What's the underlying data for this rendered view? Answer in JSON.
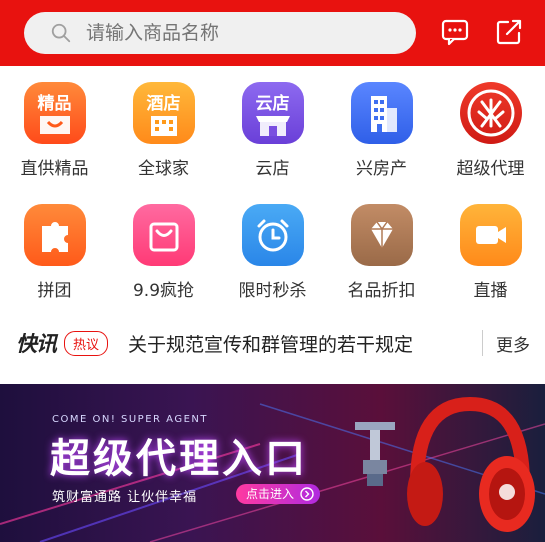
{
  "search": {
    "placeholder": "请输入商品名称"
  },
  "grid": [
    {
      "tile_text": "精品",
      "label": "直供精品",
      "icon": "bag-icon",
      "color": "#ff6a2a"
    },
    {
      "tile_text": "酒店",
      "label": "全球家",
      "icon": "hotel-icon",
      "color": "#ffa21a"
    },
    {
      "tile_text": "云店",
      "label": "云店",
      "icon": "store-icon",
      "color": "#7a4fe0"
    },
    {
      "tile_text": "",
      "label": "兴房产",
      "icon": "building-icon",
      "color": "#3f6ff0"
    },
    {
      "tile_text": "",
      "label": "超级代理",
      "icon": "agent-icon",
      "color": "#e8251f"
    },
    {
      "tile_text": "",
      "label": "拼团",
      "icon": "puzzle-icon",
      "color": "#ff7a2a"
    },
    {
      "tile_text": "",
      "label": "9.9疯抢",
      "icon": "shopping-bag-icon",
      "color": "#ff4f86"
    },
    {
      "tile_text": "",
      "label": "限时秒杀",
      "icon": "alarm-clock-icon",
      "color": "#3a9cf0"
    },
    {
      "tile_text": "",
      "label": "名品折扣",
      "icon": "diamond-icon",
      "color": "#b07a55"
    },
    {
      "tile_text": "",
      "label": "直播",
      "icon": "video-camera-icon",
      "color": "#ff9a1a"
    }
  ],
  "news": {
    "logo": "快讯",
    "badge": "热议",
    "headline": "关于规范宣传和群管理的若干规定",
    "more": "更多"
  },
  "banner": {
    "subtitle": "COME ON! SUPER AGENT",
    "title": "超级代理入口",
    "slogan": "筑财富通路 让伙伴幸福",
    "button": "点击进入"
  }
}
